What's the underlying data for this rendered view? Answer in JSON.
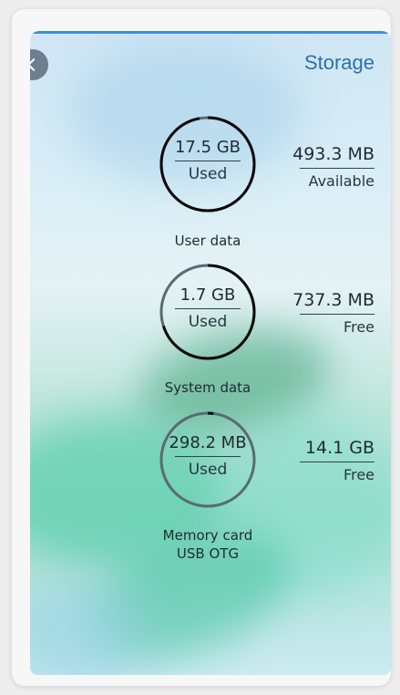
{
  "header": {
    "title": "Storage"
  },
  "storage": [
    {
      "used": "17.5 GB",
      "used_label": "Used",
      "side_value": "493.3 MB",
      "side_label": "Available",
      "caption": "User data",
      "used_fraction": 0.97
    },
    {
      "used": "1.7 GB",
      "used_label": "Used",
      "side_value": "737.3 MB",
      "side_label": "Free",
      "caption": "System data",
      "used_fraction": 0.7
    },
    {
      "used": "298.2 MB",
      "used_label": "Used",
      "side_value": "14.1 GB",
      "side_label": "Free",
      "caption": "Memory card",
      "caption_line2": "USB OTG",
      "used_fraction": 0.02
    }
  ],
  "colors": {
    "accent": "#3d8fd6",
    "title": "#2d6fb1",
    "ring_used": "#0a0a0a",
    "ring_track": "#5a6a72"
  }
}
